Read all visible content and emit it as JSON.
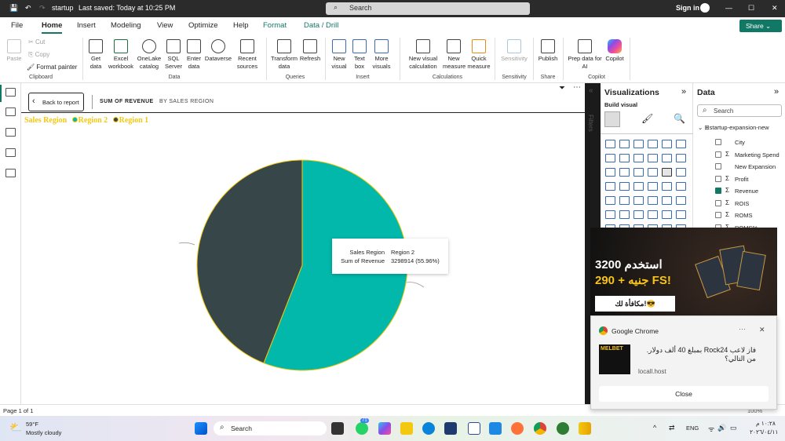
{
  "titlebar": {
    "file": "startup",
    "saved": "Last saved: Today at 10:25 PM",
    "search": "Search",
    "sign_in": "Sign in"
  },
  "tabs": [
    "File",
    "Home",
    "Insert",
    "Modeling",
    "View",
    "Optimize",
    "Help",
    "Format",
    "Data / Drill"
  ],
  "share": "Share",
  "ribbon": {
    "clipboard": {
      "paste": "Paste",
      "cut": "Cut",
      "copy": "Copy",
      "format_painter": "Format painter",
      "group": "Clipboard"
    },
    "data": {
      "items": [
        "Get data",
        "Excel workbook",
        "OneLake catalog",
        "SQL Server",
        "Enter data",
        "Dataverse",
        "Recent sources"
      ],
      "group": "Data"
    },
    "queries": {
      "items": [
        "Transform data",
        "Refresh"
      ],
      "group": "Queries"
    },
    "insert": {
      "items": [
        "New visual",
        "Text box",
        "More visuals"
      ],
      "group": "Insert"
    },
    "calculations": {
      "items": [
        "New visual calculation",
        "New measure",
        "Quick measure"
      ],
      "group": "Calculations"
    },
    "sensitivity": {
      "items": [
        "Sensitivity"
      ],
      "group": "Sensitivity"
    },
    "share": {
      "items": [
        "Publish"
      ],
      "group": "Share"
    },
    "copilot": {
      "items": [
        "Prep data for AI",
        "Copilot"
      ],
      "group": "Copilot"
    }
  },
  "canvas": {
    "back": "Back to report",
    "header1": "SUM OF REVENUE",
    "header2": "BY SALES REGION"
  },
  "chart_data": {
    "type": "pie",
    "legend_title": "Sales Region",
    "legend_position": "top-left",
    "categories": [
      "Region 2",
      "Region 1"
    ],
    "percent": [
      55.96,
      44.04
    ],
    "values": [
      3298914,
      null
    ],
    "colors": [
      "#01b8aa",
      "#374649"
    ],
    "border_color": "#f2c811"
  },
  "tooltip": {
    "label1": "Sales Region",
    "value1": "Region 2",
    "label2": "Sum of Revenue",
    "value2": "3298914 (55.96%)"
  },
  "filters": "Filters",
  "viz": {
    "title": "Visualizations",
    "build": "Build visual"
  },
  "data_pane": {
    "title": "Data",
    "search": "Search",
    "table": "startup-expansion-new",
    "fields": [
      {
        "name": "City",
        "sigma": false,
        "checked": false
      },
      {
        "name": "Marketing Spend",
        "sigma": true,
        "checked": false
      },
      {
        "name": "New Expansion",
        "sigma": false,
        "checked": false
      },
      {
        "name": "Profit",
        "sigma": true,
        "checked": false
      },
      {
        "name": "Revenue",
        "sigma": true,
        "checked": true
      },
      {
        "name": "ROIS",
        "sigma": true,
        "checked": false
      },
      {
        "name": "ROMS",
        "sigma": true,
        "checked": false
      },
      {
        "name": "ROMS%",
        "sigma": true,
        "checked": false
      }
    ]
  },
  "status": {
    "page": "Page 1 of 1",
    "zoom": "100%"
  },
  "ad": {
    "line1": "استخدم 3200",
    "line2": "جنيه + 290 FS!",
    "button": "مكافأة لك!😎"
  },
  "notification": {
    "app": "Google Chrome",
    "text": "فاز لاعب Rock24 بمبلغ 40 ألف دولار. من التالي؟",
    "source": "locall.host",
    "close": "Close",
    "thumb": "MELBET"
  },
  "taskbar": {
    "temp": "59°F",
    "weather": "Mostly cloudy",
    "search": "Search",
    "badge": "71",
    "lang": "ENG",
    "time": "١٠:٢٨ م",
    "date": "٢٠٢٦/٠٤/١١"
  }
}
